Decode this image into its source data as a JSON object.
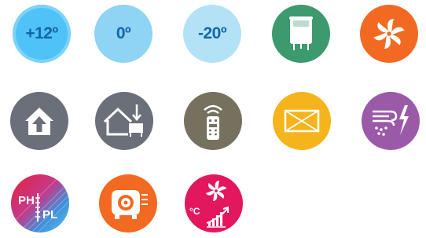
{
  "icons": [
    {
      "name": "temperature-plus-12",
      "label": "+12º",
      "color": "#4fc3f7"
    },
    {
      "name": "temperature-0",
      "label": "0º",
      "color": "#8fd3f5"
    },
    {
      "name": "temperature-minus-20",
      "label": "-20º",
      "color": "#b3e2f7"
    },
    {
      "name": "boiler-icon",
      "color": "#3d9a6e"
    },
    {
      "name": "fan-icon",
      "color": "#f26a21"
    },
    {
      "name": "house-up-arrow-icon",
      "color": "#6b6f7a"
    },
    {
      "name": "house-outdoor-unit-icon",
      "color": "#6b6f7a"
    },
    {
      "name": "remote-control-icon",
      "color": "#76705e"
    },
    {
      "name": "envelope-panel-icon",
      "color": "#f6b41c"
    },
    {
      "name": "dehumidifier-lightning-icon",
      "color": "#9b5aa8"
    },
    {
      "name": "ph-pl-gradient-icon",
      "label_top": "PH",
      "label_bottom": "PL"
    },
    {
      "name": "air-handler-icon",
      "color": "#f26a21"
    },
    {
      "name": "fan-temperature-chart-icon",
      "label": "°C",
      "color": "#e3175d"
    }
  ]
}
